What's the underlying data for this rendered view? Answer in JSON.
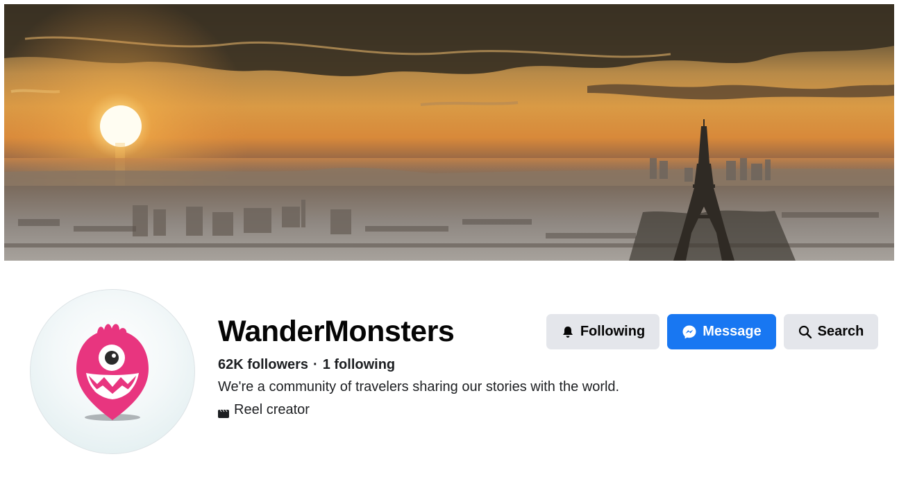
{
  "cover": {
    "image_description": "sunset-over-paris-skyline"
  },
  "profile": {
    "name": "WanderMonsters",
    "followers": "62K followers",
    "separator": "·",
    "following": "1 following",
    "bio": "We're a community of travelers sharing our stories with the world.",
    "category": "Reel creator",
    "category_icon": "reel-icon",
    "avatar_icon": "pink-monster-map-pin-logo"
  },
  "actions": {
    "following_label": "Following",
    "following_icon": "bell-icon",
    "message_label": "Message",
    "message_icon": "messenger-icon",
    "search_label": "Search",
    "search_icon": "search-icon"
  },
  "colors": {
    "primary": "#1877f2",
    "secondary_button": "#e4e6eb",
    "text": "#050505",
    "logo_pink": "#e8357f"
  }
}
